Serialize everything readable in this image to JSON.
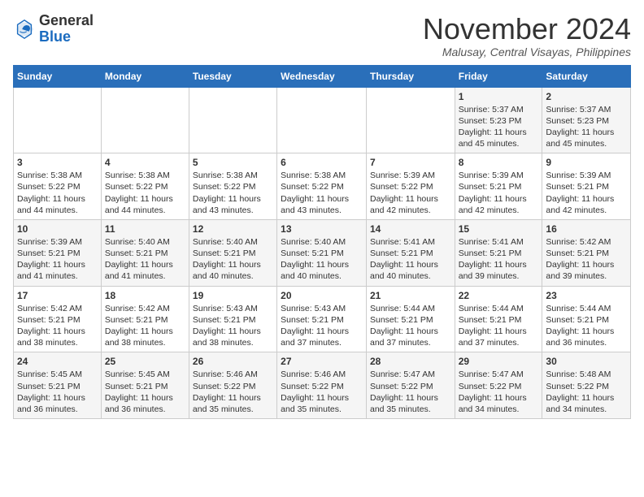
{
  "header": {
    "logo": {
      "general": "General",
      "blue": "Blue"
    },
    "title": "November 2024",
    "location": "Malusay, Central Visayas, Philippines"
  },
  "calendar": {
    "headers": [
      "Sunday",
      "Monday",
      "Tuesday",
      "Wednesday",
      "Thursday",
      "Friday",
      "Saturday"
    ],
    "weeks": [
      [
        {
          "day": "",
          "info": ""
        },
        {
          "day": "",
          "info": ""
        },
        {
          "day": "",
          "info": ""
        },
        {
          "day": "",
          "info": ""
        },
        {
          "day": "",
          "info": ""
        },
        {
          "day": "1",
          "info": "Sunrise: 5:37 AM\nSunset: 5:23 PM\nDaylight: 11 hours and 45 minutes."
        },
        {
          "day": "2",
          "info": "Sunrise: 5:37 AM\nSunset: 5:23 PM\nDaylight: 11 hours and 45 minutes."
        }
      ],
      [
        {
          "day": "3",
          "info": "Sunrise: 5:38 AM\nSunset: 5:22 PM\nDaylight: 11 hours and 44 minutes."
        },
        {
          "day": "4",
          "info": "Sunrise: 5:38 AM\nSunset: 5:22 PM\nDaylight: 11 hours and 44 minutes."
        },
        {
          "day": "5",
          "info": "Sunrise: 5:38 AM\nSunset: 5:22 PM\nDaylight: 11 hours and 43 minutes."
        },
        {
          "day": "6",
          "info": "Sunrise: 5:38 AM\nSunset: 5:22 PM\nDaylight: 11 hours and 43 minutes."
        },
        {
          "day": "7",
          "info": "Sunrise: 5:39 AM\nSunset: 5:22 PM\nDaylight: 11 hours and 42 minutes."
        },
        {
          "day": "8",
          "info": "Sunrise: 5:39 AM\nSunset: 5:21 PM\nDaylight: 11 hours and 42 minutes."
        },
        {
          "day": "9",
          "info": "Sunrise: 5:39 AM\nSunset: 5:21 PM\nDaylight: 11 hours and 42 minutes."
        }
      ],
      [
        {
          "day": "10",
          "info": "Sunrise: 5:39 AM\nSunset: 5:21 PM\nDaylight: 11 hours and 41 minutes."
        },
        {
          "day": "11",
          "info": "Sunrise: 5:40 AM\nSunset: 5:21 PM\nDaylight: 11 hours and 41 minutes."
        },
        {
          "day": "12",
          "info": "Sunrise: 5:40 AM\nSunset: 5:21 PM\nDaylight: 11 hours and 40 minutes."
        },
        {
          "day": "13",
          "info": "Sunrise: 5:40 AM\nSunset: 5:21 PM\nDaylight: 11 hours and 40 minutes."
        },
        {
          "day": "14",
          "info": "Sunrise: 5:41 AM\nSunset: 5:21 PM\nDaylight: 11 hours and 40 minutes."
        },
        {
          "day": "15",
          "info": "Sunrise: 5:41 AM\nSunset: 5:21 PM\nDaylight: 11 hours and 39 minutes."
        },
        {
          "day": "16",
          "info": "Sunrise: 5:42 AM\nSunset: 5:21 PM\nDaylight: 11 hours and 39 minutes."
        }
      ],
      [
        {
          "day": "17",
          "info": "Sunrise: 5:42 AM\nSunset: 5:21 PM\nDaylight: 11 hours and 38 minutes."
        },
        {
          "day": "18",
          "info": "Sunrise: 5:42 AM\nSunset: 5:21 PM\nDaylight: 11 hours and 38 minutes."
        },
        {
          "day": "19",
          "info": "Sunrise: 5:43 AM\nSunset: 5:21 PM\nDaylight: 11 hours and 38 minutes."
        },
        {
          "day": "20",
          "info": "Sunrise: 5:43 AM\nSunset: 5:21 PM\nDaylight: 11 hours and 37 minutes."
        },
        {
          "day": "21",
          "info": "Sunrise: 5:44 AM\nSunset: 5:21 PM\nDaylight: 11 hours and 37 minutes."
        },
        {
          "day": "22",
          "info": "Sunrise: 5:44 AM\nSunset: 5:21 PM\nDaylight: 11 hours and 37 minutes."
        },
        {
          "day": "23",
          "info": "Sunrise: 5:44 AM\nSunset: 5:21 PM\nDaylight: 11 hours and 36 minutes."
        }
      ],
      [
        {
          "day": "24",
          "info": "Sunrise: 5:45 AM\nSunset: 5:21 PM\nDaylight: 11 hours and 36 minutes."
        },
        {
          "day": "25",
          "info": "Sunrise: 5:45 AM\nSunset: 5:21 PM\nDaylight: 11 hours and 36 minutes."
        },
        {
          "day": "26",
          "info": "Sunrise: 5:46 AM\nSunset: 5:22 PM\nDaylight: 11 hours and 35 minutes."
        },
        {
          "day": "27",
          "info": "Sunrise: 5:46 AM\nSunset: 5:22 PM\nDaylight: 11 hours and 35 minutes."
        },
        {
          "day": "28",
          "info": "Sunrise: 5:47 AM\nSunset: 5:22 PM\nDaylight: 11 hours and 35 minutes."
        },
        {
          "day": "29",
          "info": "Sunrise: 5:47 AM\nSunset: 5:22 PM\nDaylight: 11 hours and 34 minutes."
        },
        {
          "day": "30",
          "info": "Sunrise: 5:48 AM\nSunset: 5:22 PM\nDaylight: 11 hours and 34 minutes."
        }
      ]
    ]
  }
}
